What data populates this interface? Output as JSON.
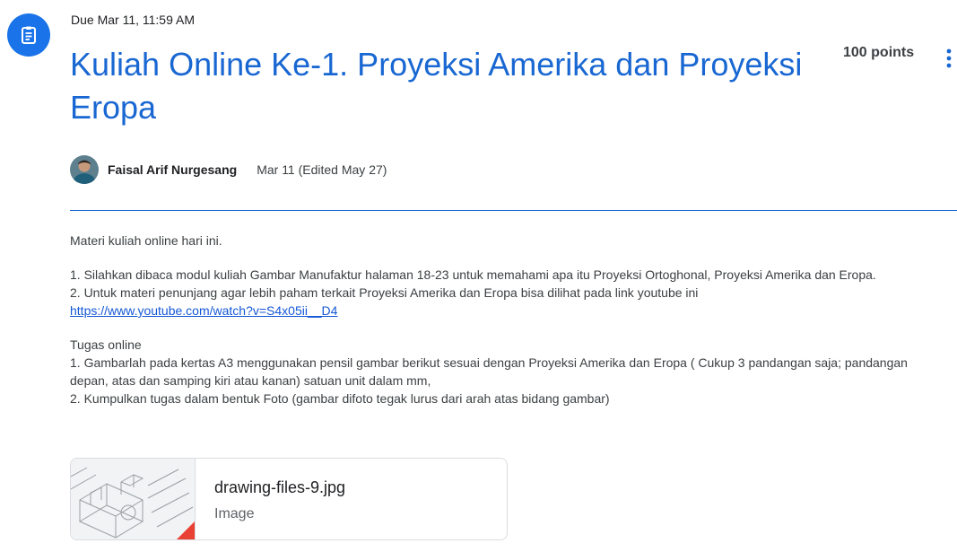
{
  "header": {
    "icon": "assignment-icon",
    "due": "Due Mar 11, 11:59 AM",
    "title": "Kuliah Online Ke-1. Proyeksi Amerika dan Proyeksi Eropa",
    "points": "100 points",
    "more_icon": "more-vert-icon"
  },
  "author": {
    "name": "Faisal Arif Nurgesang",
    "date": "Mar 11 (Edited May 27)"
  },
  "colors": {
    "accent": "#1967d2",
    "icon_bg": "#1a73e8"
  },
  "body": {
    "intro": "Materi kuliah online hari ini.",
    "item1": "1. Silahkan dibaca modul kuliah Gambar Manufaktur halaman 18-23 untuk memahami apa itu Proyeksi Ortoghonal, Proyeksi Amerika dan Eropa.",
    "item2": "2. Untuk materi penunjang agar lebih paham terkait Proyeksi Amerika dan Eropa bisa dilihat pada link youtube ini",
    "link": "https://www.youtube.com/watch?v=S4x05ii__D4",
    "task_heading": "Tugas online",
    "task1": "1. Gambarlah pada kertas A3 menggunakan pensil gambar berikut sesuai dengan Proyeksi Amerika dan Eropa ( Cukup 3 pandangan saja; pandangan depan, atas dan samping kiri atau kanan) satuan unit dalam mm,",
    "task2": "2. Kumpulkan tugas dalam bentuk Foto (gambar difoto tegak lurus dari arah atas bidang gambar)"
  },
  "attachment": {
    "name": "drawing-files-9.jpg",
    "type": "Image"
  }
}
